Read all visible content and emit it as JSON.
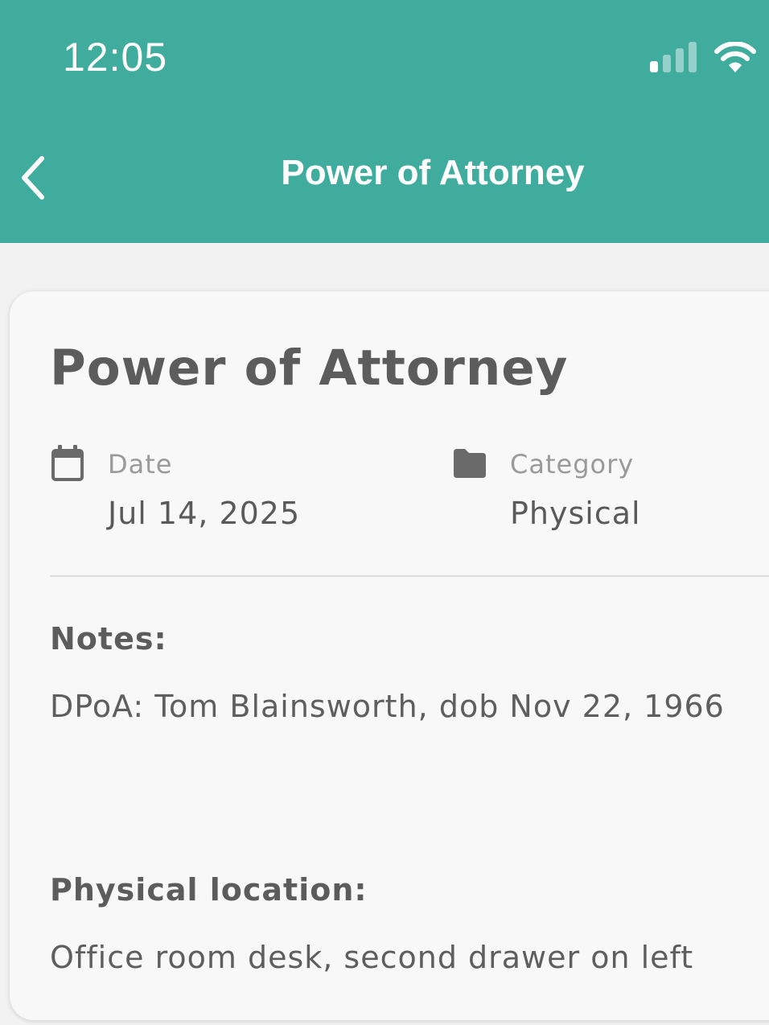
{
  "status_bar": {
    "time": "12:05",
    "signal_icon": "cellular-signal-icon",
    "wifi_icon": "wifi-icon"
  },
  "nav_bar": {
    "title": "Power of Attorney",
    "back_icon": "chevron-left-icon",
    "background_color": "#3fac9e"
  },
  "document": {
    "title": "Power of Attorney",
    "date": {
      "icon": "calendar-icon",
      "label": "Date",
      "value": "Jul 14, 2025"
    },
    "category": {
      "icon": "folder-icon",
      "label": "Category",
      "value": "Physical"
    },
    "notes": {
      "heading": "Notes:",
      "text": "DPoA: Tom Blainsworth, dob Nov 22, 1966"
    },
    "physical_location": {
      "heading": "Physical location:",
      "text": "Office room desk, second drawer on left"
    }
  }
}
